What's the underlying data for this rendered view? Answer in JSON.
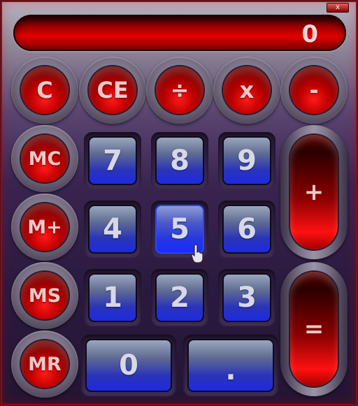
{
  "window": {
    "close_label": "x"
  },
  "display": {
    "value": "0"
  },
  "buttons": {
    "c": "C",
    "ce": "CE",
    "divide": "÷",
    "multiply": "x",
    "minus": "-",
    "mc": "MC",
    "mplus": "M+",
    "ms": "MS",
    "mr": "MR",
    "plus": "+",
    "equals": "=",
    "d7": "7",
    "d8": "8",
    "d9": "9",
    "d4": "4",
    "d5": "5",
    "d6": "6",
    "d1": "1",
    "d2": "2",
    "d3": "3",
    "d0": "0",
    "dot": "."
  },
  "colors": {
    "accent_red": "#e10000",
    "digit_blue": "#1d2ae0",
    "background": "#2b1a40"
  },
  "state": {
    "hovered_button": "5"
  }
}
